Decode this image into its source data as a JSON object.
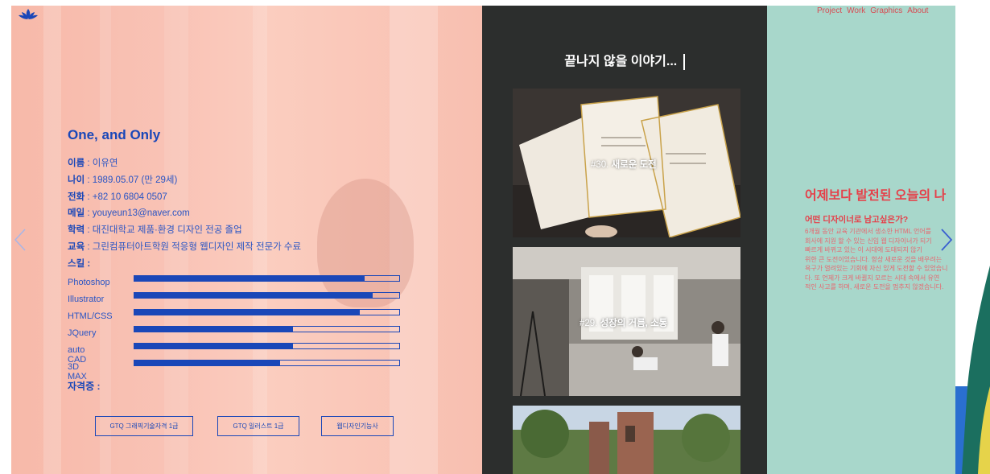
{
  "nav": {
    "items": [
      "Project",
      "Work",
      "Graphics",
      "About"
    ]
  },
  "profile": {
    "title": "One, and Only",
    "info": [
      {
        "key": "이름",
        "sep": " : ",
        "value": "이유연"
      },
      {
        "key": "나이",
        "sep": " : ",
        "value": "1989.05.07 (만 29세)"
      },
      {
        "key": "전화",
        "sep": " : ",
        "value": "+82 10 6804 0507"
      },
      {
        "key": "메일",
        "sep": " : ",
        "value": "youyeun13@naver.com"
      },
      {
        "key": "학력",
        "sep": " : ",
        "value": "대진대학교 제품·환경 디자인 전공 졸업"
      },
      {
        "key": "교육",
        "sep": " : ",
        "value": "그린컴퓨터아트학원 적응형 웹디자인 제작 전문가 수료"
      }
    ],
    "skills_label": "스킬 :",
    "skills": [
      {
        "name": "Photoshop",
        "level": 0.87
      },
      {
        "name": "Illustrator",
        "level": 0.9
      },
      {
        "name": "HTML/CSS",
        "level": 0.85
      },
      {
        "name": "JQuery",
        "level": 0.6
      },
      {
        "name": "auto CAD",
        "level": 0.6
      },
      {
        "name": "3D MAX",
        "level": 0.55
      }
    ],
    "cert_label": "자격증 :",
    "certs": [
      "GTQ 그래픽기술자격 1급",
      "GTQ 일러스트 1급",
      "웹디자인기능사"
    ]
  },
  "stories": {
    "title": "끝나지 않을 이야기...",
    "cards": [
      {
        "caption_prefix": "#30. ",
        "caption_main": "새로운 도전"
      },
      {
        "caption_prefix": "#29. ",
        "caption_main": "성장의 거름, 소통"
      },
      {
        "caption_prefix": "",
        "caption_main": ""
      }
    ]
  },
  "intro": {
    "headline": "어제보다 발전된 오늘의 나",
    "subhead": "어떤 디자이너로 남고싶은가?",
    "paragraph": [
      "6개월 동안 교육 기관에서 생소한 HTML 언어를",
      "회사에 지원 할 수 있는 신입 웹 디자이너가 되기",
      "빠르게 바뀌고 있는 이 시대에 도태되지 않기",
      "위한 큰 도전이었습니다. 항상 새로운 것을 배우려는",
      "욕구가 열려있는 기회에 자신 있게 도전할 수 있었습니",
      "다. 또 언제가 크게 바뀔지 모르는 시대 속에서 유연",
      "적인 사고를 하며, 새로운 도전을 멈추지 않겠습니다."
    ]
  },
  "colors": {
    "blue": "#1a47b8",
    "coral": "#e5404a",
    "teal": "#a8d7cb",
    "dark": "#2c2e2d"
  }
}
